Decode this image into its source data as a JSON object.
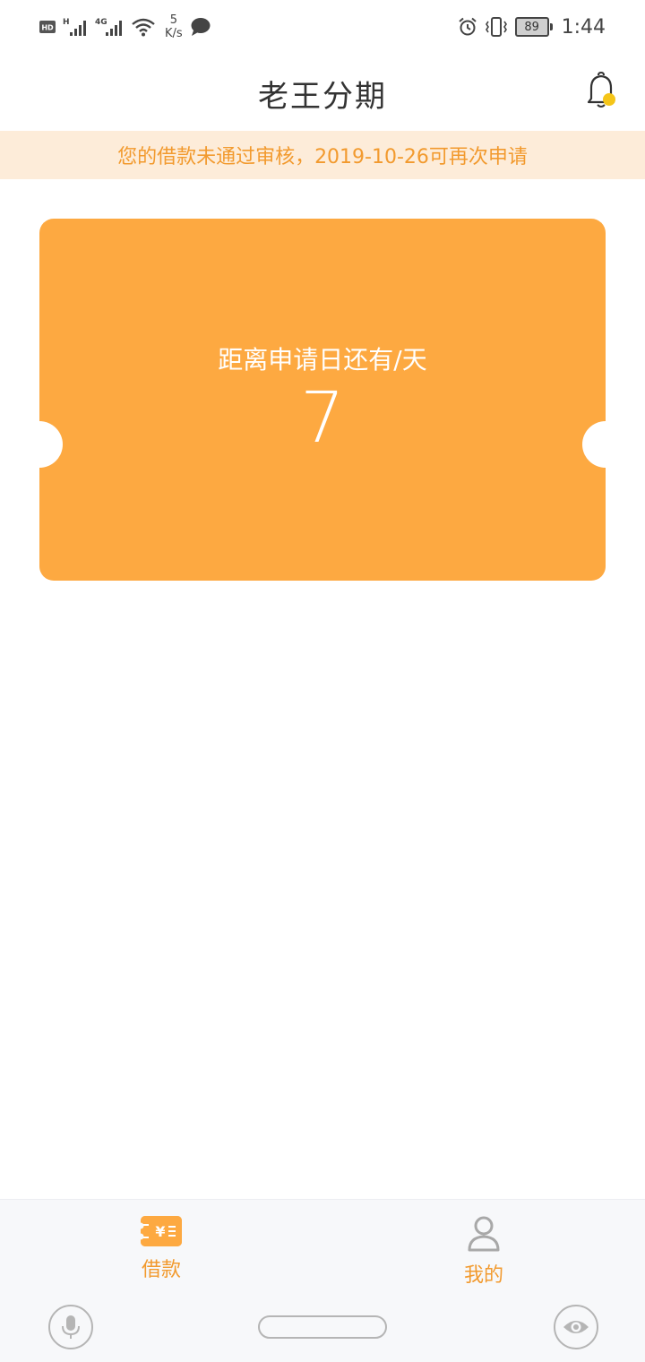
{
  "status_bar": {
    "hd_badge": "HD",
    "signal1_type": "H",
    "signal2_type": "4G",
    "speed_value": "5",
    "speed_unit": "K/s",
    "battery": "89",
    "time": "1:44"
  },
  "header": {
    "title": "老王分期",
    "notification_icon": "bell-icon"
  },
  "notice": {
    "text": "您的借款未通过审核，2019-10-26可再次申请"
  },
  "ticket": {
    "label": "距离申请日还有/天",
    "days": "7"
  },
  "bottom_nav": {
    "items": [
      {
        "label": "借款",
        "icon": "loan-icon",
        "active": true
      },
      {
        "label": "我的",
        "icon": "user-icon",
        "active": false
      }
    ]
  },
  "colors": {
    "accent": "#fda941",
    "accent_text": "#f29a2e",
    "notice_bg": "#fdecd9"
  }
}
